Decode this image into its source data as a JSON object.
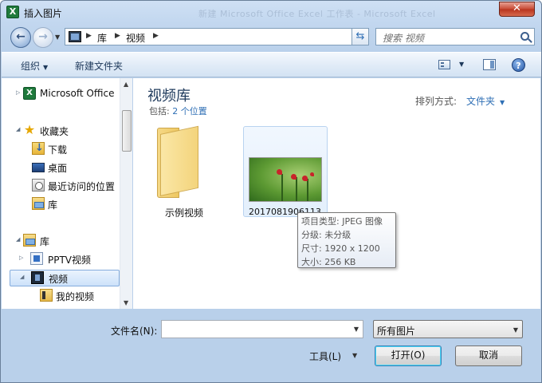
{
  "window": {
    "title": "插入图片",
    "bg_title": "新建 Microsoft Office Excel 工作表 - Microsoft Excel",
    "close_label": "✕"
  },
  "address": {
    "crumbs": [
      "库",
      "视频"
    ],
    "search_placeholder": "搜索 视频"
  },
  "toolbar": {
    "organize": "组织",
    "new_folder": "新建文件夹"
  },
  "navpane": {
    "items": [
      {
        "label": "Microsoft Office",
        "icon": "excel-icon"
      },
      {
        "label": "收藏夹",
        "icon": "star-icon"
      },
      {
        "label": "下载",
        "icon": "download-folder-icon"
      },
      {
        "label": "桌面",
        "icon": "desktop-icon"
      },
      {
        "label": "最近访问的位置",
        "icon": "recent-places-icon"
      },
      {
        "label": "库",
        "icon": "library-icon"
      },
      {
        "label": "库",
        "icon": "library-icon"
      },
      {
        "label": "PPTV视频",
        "icon": "pptv-icon"
      },
      {
        "label": "视频",
        "icon": "video-library-icon",
        "selected": true
      },
      {
        "label": "我的视频",
        "icon": "my-videos-icon"
      }
    ]
  },
  "content": {
    "library_title": "视频库",
    "includes_label": "包括:",
    "includes_link": "2 个位置",
    "arrange_label": "排列方式:",
    "arrange_value": "文件夹",
    "items": [
      {
        "name": "示例视频",
        "type": "folder"
      },
      {
        "name": "2017081906113",
        "type": "image"
      }
    ],
    "tooltip": {
      "type_line": "项目类型: JPEG 图像",
      "rating_line": "分级: 未分级",
      "dimensions_line": "尺寸: 1920 x 1200",
      "size_line": "大小: 256 KB"
    }
  },
  "footer": {
    "filename_label": "文件名(N):",
    "filename_value": "",
    "filetype_value": "所有图片",
    "tools_label": "工具(L)",
    "open_label": "打开(O)",
    "cancel_label": "取消"
  },
  "colors": {
    "accent_text": "#1e395b",
    "link": "#2f6fb5",
    "window_frame": "#b9d0ea"
  }
}
